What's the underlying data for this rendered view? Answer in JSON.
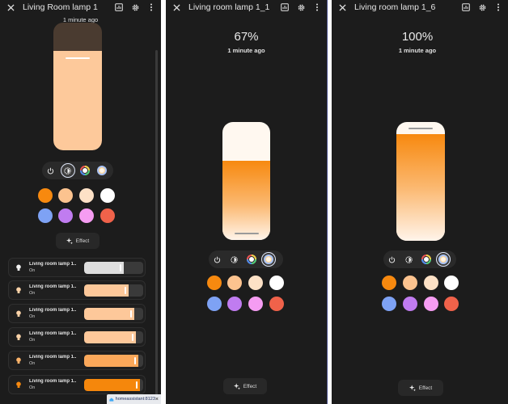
{
  "panel1": {
    "title": "Living Room lamp 1",
    "top_text": "1 minute ago",
    "effect_label": "Effect",
    "cards": [
      {
        "name": "Living room lamp 1...",
        "state": "On",
        "brightness": 0.67,
        "color": "#dedede"
      },
      {
        "name": "Living room lamp 1...",
        "state": "On",
        "brightness": 0.75,
        "color": "#fdc89a"
      },
      {
        "name": "Living room lamp 1...",
        "state": "On",
        "brightness": 0.85,
        "color": "#fdc89a"
      },
      {
        "name": "Living room lamp 1...",
        "state": "On",
        "brightness": 0.88,
        "color": "#fdc89a"
      },
      {
        "name": "Living room lamp 1...",
        "state": "On",
        "brightness": 0.92,
        "color": "#fba85a"
      },
      {
        "name": "Living room lamp 1...",
        "state": "On",
        "brightness": 0.95,
        "color": "#f5870c"
      }
    ],
    "tooltip": "homeassistant:8123",
    "tooltip_close": "×"
  },
  "panel2": {
    "title": "Living room lamp 1_1",
    "brightness_text": "67%",
    "ago": "1 minute ago",
    "brightness": 0.67,
    "effect_label": "Effect"
  },
  "panel3": {
    "title": "Living room lamp 1_6",
    "brightness_text": "100%",
    "ago": "1 minute ago",
    "brightness": 1.0,
    "effect_label": "Effect"
  },
  "swatch_colors": [
    "#f7890f",
    "#fcc38f",
    "#fde1c6",
    "#ffffff",
    "#7ea2f4",
    "#c07cf0",
    "#f59cf2",
    "#f0624a"
  ],
  "accent_colors": {
    "orange": "#f7890f",
    "peach": "#fdc99b",
    "background": "#1c1c1c"
  },
  "icons": [
    "close-icon",
    "chart-icon",
    "gear-icon",
    "more-vert-icon",
    "power-icon",
    "brightness-icon",
    "color-wheel-icon",
    "color-temp-icon",
    "sparkle-icon",
    "bulb-icon"
  ]
}
